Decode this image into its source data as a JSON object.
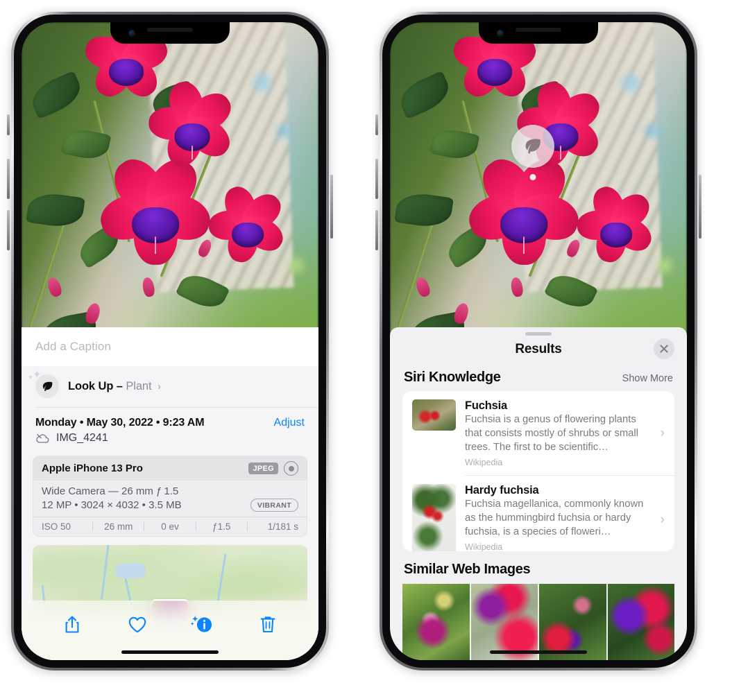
{
  "left_phone": {
    "caption_placeholder": "Add a Caption",
    "lookup": {
      "label": "Look Up –",
      "subject": "Plant",
      "chevron": "›",
      "icon": "leaf-icon"
    },
    "date_line": "Monday • May 30, 2022 • 9:23 AM",
    "adjust_label": "Adjust",
    "file_name": "IMG_4241",
    "cloud_icon": "icloud-slash-icon",
    "exif": {
      "device": "Apple iPhone 13 Pro",
      "format_badge": "JPEG",
      "lens_icon": "lens-icon",
      "lens_line": "Wide Camera — 26 mm ƒ 1.5",
      "specs_line": "12 MP • 3024 × 4032 • 3.5 MB",
      "style_badge": "VIBRANT",
      "stats": [
        "ISO 50",
        "26 mm",
        "0 ev",
        "ƒ1.5",
        "1/181 s"
      ]
    },
    "toolbar": [
      {
        "name": "share-button",
        "icon": "share-icon"
      },
      {
        "name": "favorite-button",
        "icon": "heart-icon"
      },
      {
        "name": "info-button",
        "icon": "info-sparkle-icon"
      },
      {
        "name": "delete-button",
        "icon": "trash-icon"
      }
    ]
  },
  "right_phone": {
    "badge": {
      "icon": "leaf-icon"
    },
    "results_title": "Results",
    "close_icon": "close-icon",
    "siri_section": {
      "title": "Siri Knowledge",
      "action": "Show More",
      "cards": [
        {
          "title": "Fuchsia",
          "description": "Fuchsia is a genus of flowering plants that consists mostly of shrubs or small trees. The first to be scientific…",
          "source": "Wikipedia",
          "chevron": "›"
        },
        {
          "title": "Hardy fuchsia",
          "description": "Fuchsia magellanica, commonly known as the hummingbird fuchsia or hardy fuchsia, is a species of floweri…",
          "source": "Wikipedia",
          "chevron": "›"
        }
      ]
    },
    "similar_section": {
      "title": "Similar Web Images",
      "images": [
        "web-image-1",
        "web-image-2",
        "web-image-3",
        "web-image-4"
      ]
    }
  },
  "colors": {
    "accent_blue": "#0a84ff",
    "sheet_gray": "#f1f1f4",
    "card_white": "#ffffff",
    "secondary_text": "#8e8e93"
  }
}
